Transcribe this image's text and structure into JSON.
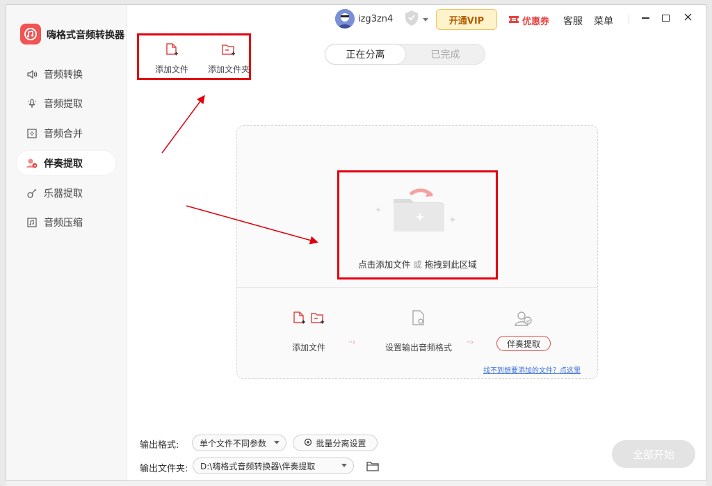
{
  "app": {
    "title": "嗨格式音频转换器"
  },
  "header": {
    "username": "izg3zn4",
    "vip_label": "开通VIP",
    "coupon_label": "优惠券",
    "service_label": "客服",
    "menu_label": "菜单"
  },
  "sidebar": {
    "items": [
      {
        "label": "音频转换",
        "icon": "speaker-icon"
      },
      {
        "label": "音频提取",
        "icon": "mic-extract-icon"
      },
      {
        "label": "音频合并",
        "icon": "merge-icon"
      },
      {
        "label": "伴奏提取",
        "icon": "accompaniment-icon",
        "active": true
      },
      {
        "label": "乐器提取",
        "icon": "guitar-icon"
      },
      {
        "label": "音频压缩",
        "icon": "compress-icon"
      }
    ]
  },
  "toolbar": {
    "add_file": "添加文件",
    "add_folder": "添加文件夹"
  },
  "tabs": {
    "processing": "正在分离",
    "done": "已完成"
  },
  "drop": {
    "click_text": "点击添加文件",
    "or_text": "或",
    "drag_text": "拖拽到此区域"
  },
  "steps": {
    "add_file": "添加文件",
    "set_format": "设置输出音频格式",
    "accompaniment": "伴奏提取",
    "help_link": "找不到想要添加的文件？点这里"
  },
  "bottom": {
    "format_label": "输出格式:",
    "format_value": "单个文件不同参数",
    "batch_label": "批量分离设置",
    "folder_label": "输出文件夹:",
    "folder_value": "D:\\嗨格式音频转换器\\伴奏提取",
    "start_label": "全部开始"
  },
  "colors": {
    "accent": "#f25353",
    "highlight": "#e3000f",
    "vip_bg": "#fff3cc",
    "link": "#3a6fd8"
  }
}
